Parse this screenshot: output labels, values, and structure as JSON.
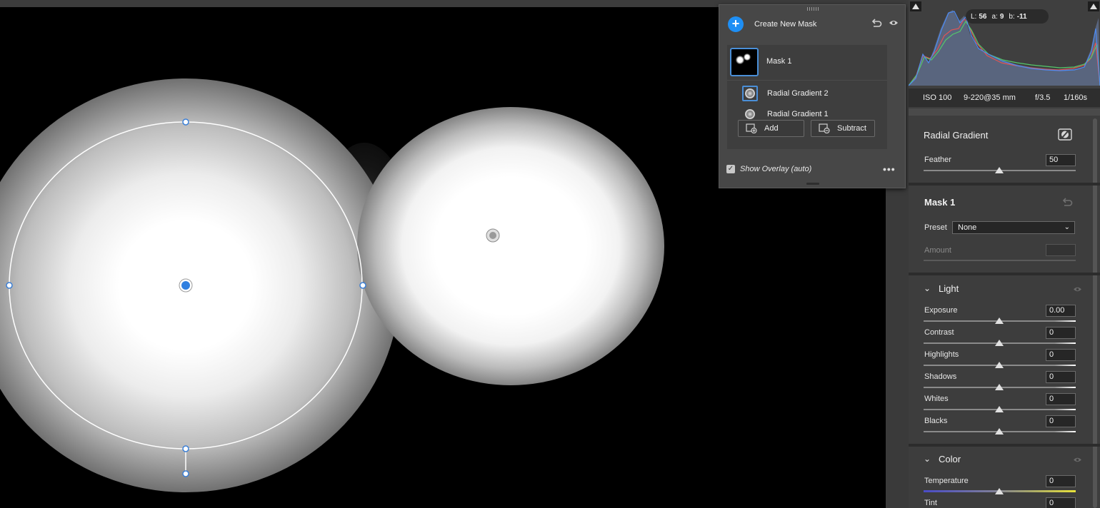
{
  "masks_panel": {
    "create_label": "Create New Mask",
    "mask_name": "Mask 1",
    "components": [
      {
        "label": "Radial Gradient 2",
        "selected": true
      },
      {
        "label": "Radial Gradient 1",
        "selected": false
      }
    ],
    "add_label": "Add",
    "subtract_label": "Subtract",
    "overlay_label": "Show Overlay (auto)",
    "overlay_checked": true,
    "more_label": "•••"
  },
  "histogram": {
    "L_label": "L:",
    "L_value": "56",
    "a_label": "a:",
    "a_value": "9",
    "b_label": "b:",
    "b_value": "-11"
  },
  "exif": {
    "iso": "ISO 100",
    "lens": "9-220@35 mm",
    "aperture": "f/3.5",
    "shutter": "1/160s"
  },
  "radial_gradient": {
    "title": "Radial Gradient",
    "feather_label": "Feather",
    "feather_value": "50"
  },
  "mask_section": {
    "title": "Mask 1",
    "preset_label": "Preset",
    "preset_value": "None",
    "amount_label": "Amount"
  },
  "light": {
    "title": "Light",
    "sliders": [
      {
        "label": "Exposure",
        "value": "0.00"
      },
      {
        "label": "Contrast",
        "value": "0"
      },
      {
        "label": "Highlights",
        "value": "0"
      },
      {
        "label": "Shadows",
        "value": "0"
      },
      {
        "label": "Whites",
        "value": "0"
      },
      {
        "label": "Blacks",
        "value": "0"
      }
    ]
  },
  "color": {
    "title": "Color",
    "sliders": [
      {
        "label": "Temperature",
        "value": "0"
      },
      {
        "label": "Tint",
        "value": "0"
      }
    ]
  },
  "colors": {
    "accent": "#1e8ff5",
    "selection": "#4a8fd8",
    "panel": "#3d3d3d"
  }
}
